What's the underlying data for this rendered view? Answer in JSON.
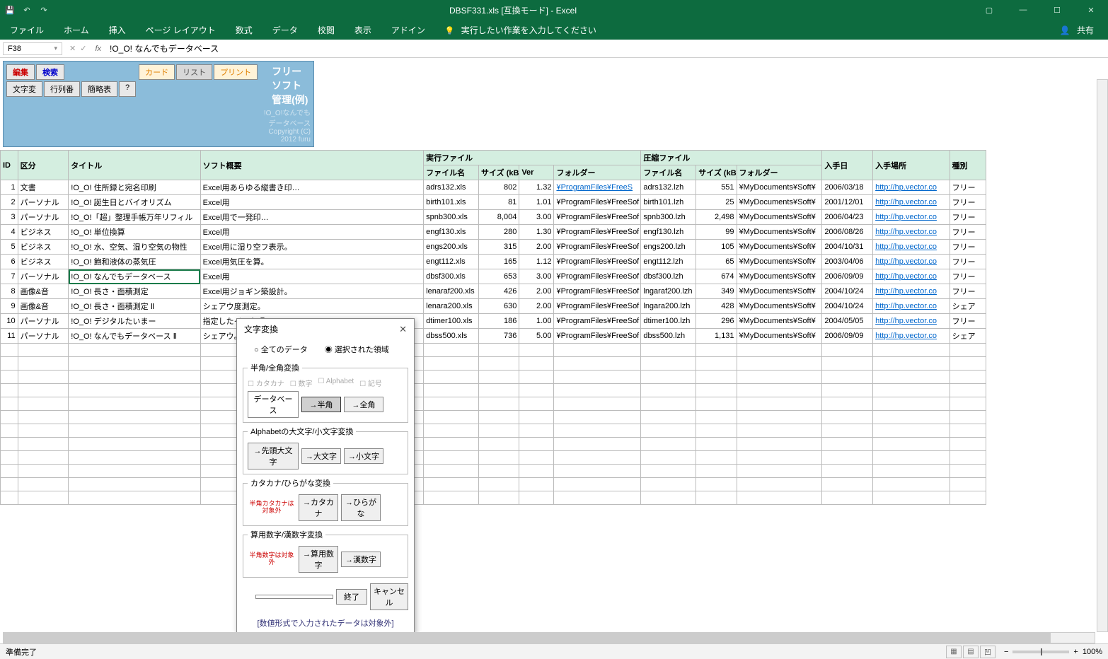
{
  "titlebar": {
    "title": "DBSF331.xls  [互換モード] - Excel",
    "share": "共有"
  },
  "ribbon": {
    "tabs": [
      "ファイル",
      "ホーム",
      "挿入",
      "ページ レイアウト",
      "数式",
      "データ",
      "校閲",
      "表示",
      "アドイン"
    ],
    "tellme": "実行したい作業を入力してください"
  },
  "formula": {
    "name": "F38",
    "content": "!O_O! なんでもデータベース"
  },
  "menu": {
    "edit": "編集",
    "search": "検索",
    "card": "カード",
    "list": "リスト",
    "print": "プリント",
    "mojihen": "文字変",
    "gyoban": "行列番",
    "kanryaku": "簡略表",
    "help": "?",
    "title": "フリーソフト管理(例)",
    "sub1": "!O_O!なんでもデータベース",
    "sub2": "Copyright (C) 2012 furu"
  },
  "headers": {
    "id": "ID",
    "cat": "区分",
    "title": "タイトル",
    "desc": "ソフト概要",
    "exec": "実行ファイル",
    "fn": "ファイル名",
    "sz": "サイズ (kB)",
    "ver": "Ver",
    "fld": "フォルダー",
    "zip": "圧縮ファイル",
    "zfn": "ファイル名",
    "zsz": "サイズ (kB)",
    "zfld": "フォルダー",
    "date": "入手日",
    "url": "入手場所",
    "kind": "種別"
  },
  "rows": [
    {
      "id": "1",
      "cat": "文書",
      "title": "!O_O! 住所録と宛名印刷",
      "desc": "Excel用あらゆる縦書き印…",
      "fn": "adrs132.xls",
      "sz": "802",
      "ver": "1.32",
      "fld": "¥ProgramFiles¥FreeS",
      "zfn": "adrs132.lzh",
      "zsz": "551",
      "zfld": "¥MyDocuments¥Soft¥",
      "date": "2006/03/18",
      "url": "http://hp.vector.co",
      "kind": "フリー"
    },
    {
      "id": "2",
      "cat": "パーソナル",
      "title": "!O_O! 誕生日とバイオリズム",
      "desc": "Excel用",
      "fn": "birth101.xls",
      "sz": "81",
      "ver": "1.01",
      "fld": "¥ProgramFiles¥FreeSof",
      "zfn": "birth101.lzh",
      "zsz": "25",
      "zfld": "¥MyDocuments¥Soft¥",
      "date": "2001/12/01",
      "url": "http://hp.vector.co",
      "kind": "フリー"
    },
    {
      "id": "3",
      "cat": "パーソナル",
      "title": "!O_O!「超」整理手帳万年リフィル",
      "desc": "Excel用で一発印…",
      "fn": "spnb300.xls",
      "sz": "8,004",
      "ver": "3.00",
      "fld": "¥ProgramFiles¥FreeSof",
      "zfn": "spnb300.lzh",
      "zsz": "2,498",
      "zfld": "¥MyDocuments¥Soft¥",
      "date": "2006/04/23",
      "url": "http://hp.vector.co",
      "kind": "フリー"
    },
    {
      "id": "4",
      "cat": "ビジネス",
      "title": "!O_O! 単位換算",
      "desc": "Excel用",
      "fn": "engf130.xls",
      "sz": "280",
      "ver": "1.30",
      "fld": "¥ProgramFiles¥FreeSof",
      "zfn": "engf130.lzh",
      "zsz": "99",
      "zfld": "¥MyDocuments¥Soft¥",
      "date": "2006/08/26",
      "url": "http://hp.vector.co",
      "kind": "フリー"
    },
    {
      "id": "5",
      "cat": "ビジネス",
      "title": "!O_O! 水、空気、湿り空気の物性",
      "desc": "Excel用に湿り空フ表示。",
      "fn": "engs200.xls",
      "sz": "315",
      "ver": "2.00",
      "fld": "¥ProgramFiles¥FreeSof",
      "zfn": "engs200.lzh",
      "zsz": "105",
      "zfld": "¥MyDocuments¥Soft¥",
      "date": "2004/10/31",
      "url": "http://hp.vector.co",
      "kind": "フリー"
    },
    {
      "id": "6",
      "cat": "ビジネス",
      "title": "!O_O! 飽和液体の蒸気圧",
      "desc": "Excel用気圧を算。",
      "fn": "engt112.xls",
      "sz": "165",
      "ver": "1.12",
      "fld": "¥ProgramFiles¥FreeSof",
      "zfn": "engt112.lzh",
      "zsz": "65",
      "zfld": "¥MyDocuments¥Soft¥",
      "date": "2003/04/06",
      "url": "http://hp.vector.co",
      "kind": "フリー"
    },
    {
      "id": "7",
      "cat": "パーソナル",
      "title": "!O_O! なんでもデータベース",
      "desc": "Excel用",
      "fn": "dbsf300.xls",
      "sz": "653",
      "ver": "3.00",
      "fld": "¥ProgramFiles¥FreeSof",
      "zfn": "dbsf300.lzh",
      "zsz": "674",
      "zfld": "¥MyDocuments¥Soft¥",
      "date": "2006/09/09",
      "url": "http://hp.vector.co",
      "kind": "フリー"
    },
    {
      "id": "8",
      "cat": "画像&音",
      "title": "!O_O! 長さ・面積測定",
      "desc": "Excel用ジョギン築設計。",
      "fn": "lenaraf200.xls",
      "sz": "426",
      "ver": "2.00",
      "fld": "¥ProgramFiles¥FreeSof",
      "zfn": "lngaraf200.lzh",
      "zsz": "349",
      "zfld": "¥MyDocuments¥Soft¥",
      "date": "2004/10/24",
      "url": "http://hp.vector.co",
      "kind": "フリー"
    },
    {
      "id": "9",
      "cat": "画像&音",
      "title": "!O_O! 長さ・面積測定 Ⅱ",
      "desc": "シェアウ度測定。",
      "fn": "lenara200.xls",
      "sz": "630",
      "ver": "2.00",
      "fld": "¥ProgramFiles¥FreeSof",
      "zfn": "lngara200.lzh",
      "zsz": "428",
      "zfld": "¥MyDocuments¥Soft¥",
      "date": "2004/10/24",
      "url": "http://hp.vector.co",
      "kind": "シェア"
    },
    {
      "id": "10",
      "cat": "パーソナル",
      "title": "!O_O! デジタルたいまー",
      "desc": "指定したイルを唄。",
      "fn": "dtimer100.xls",
      "sz": "186",
      "ver": "1.00",
      "fld": "¥ProgramFiles¥FreeSof",
      "zfn": "dtimer100.lzh",
      "zsz": "296",
      "zfld": "¥MyDocuments¥Soft¥",
      "date": "2004/05/05",
      "url": "http://hp.vector.co",
      "kind": "フリー"
    },
    {
      "id": "11",
      "cat": "パーソナル",
      "title": "!O_O! なんでもデータベース Ⅱ",
      "desc": "シェアウ。",
      "fn": "dbss500.xls",
      "sz": "736",
      "ver": "5.00",
      "fld": "¥ProgramFiles¥FreeSof",
      "zfn": "dbss500.lzh",
      "zsz": "1,131",
      "zfld": "¥MyDocuments¥Soft¥",
      "date": "2006/09/09",
      "url": "http://hp.vector.co",
      "kind": "シェア"
    }
  ],
  "dialog": {
    "title": "文字変換",
    "radio_all": "全てのデータ",
    "radio_sel": "選択された領域",
    "g1": {
      "legend": "半角/全角変換",
      "cb_kata": "カタカナ",
      "cb_num": "数字",
      "cb_alpha": "Alphabet",
      "cb_sym": "記号",
      "tbox": "データベース",
      "b_half": "→半角",
      "b_full": "→全角"
    },
    "g2": {
      "legend": "Alphabetの大文字/小文字変換",
      "b1": "→先頭大文字",
      "b2": "→大文字",
      "b3": "→小文字"
    },
    "g3": {
      "legend": "カタカナ/ひらがな変換",
      "note": "半角カタカナは対象外",
      "b1": "→カタカナ",
      "b2": "→ひらがな"
    },
    "g4": {
      "legend": "算用数字/漢数字変換",
      "note": "半角数字は対象外",
      "b1": "→算用数字",
      "b2": "→漢数字"
    },
    "done": "終了",
    "cancel": "キャンセル",
    "foot": "[数値形式で入力されたデータは対象外]"
  },
  "status": {
    "ready": "準備完了",
    "zoom": "100%"
  }
}
